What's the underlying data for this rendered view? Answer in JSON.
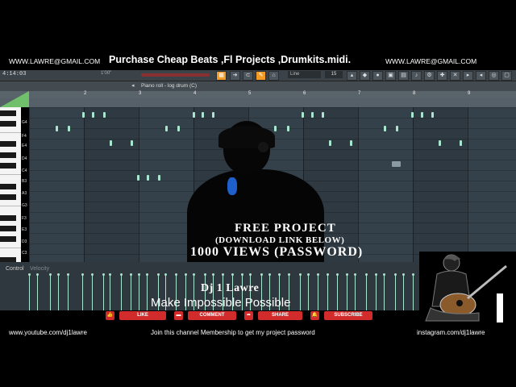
{
  "banner": {
    "email_left": "WWW.LAWRE@GMAIL.COM",
    "promo": "Purchase Cheap Beats ,Fl Projects ,Drumkits.midi.",
    "email_right": "WWW.LAWRE@GMAIL.COM"
  },
  "toolbar": {
    "time": "4:14:03",
    "position": "1'00\"",
    "snap": "Line",
    "step": "15"
  },
  "piano_roll": {
    "title": "Piano roll - log drum (C)",
    "bars": [
      "2",
      "3",
      "4",
      "5",
      "6",
      "7",
      "8",
      "9"
    ],
    "note_labels": [
      "G4",
      "F4",
      "E4",
      "D4",
      "C4",
      "B3",
      "A3",
      "G3",
      "F3",
      "E3",
      "D3",
      "C3"
    ],
    "control_label": "Control",
    "control_param": "Velocity"
  },
  "overlay": {
    "line1": "FREE PROJECT",
    "line2": "(DOWNLOAD LINK BELOW)",
    "line3": "1000 VIEWS (PASSWORD)",
    "brand": "Dj 1 Lawre",
    "tagline": "Make Impossible Possible"
  },
  "actions": {
    "like": "LIKE",
    "comment": "COMMENT",
    "share": "SHARE",
    "subscribe": "SUBSCRIBE"
  },
  "footer": {
    "youtube": "www.youtube.com/dj1lawre",
    "membership": "Join this channel Membership to get my project password",
    "instagram": "instagram.com/dj1lawre"
  },
  "colors": {
    "note": "#a9e6cf",
    "accent_red": "#d22b2b",
    "toolbar_orange": "#f29b25"
  }
}
